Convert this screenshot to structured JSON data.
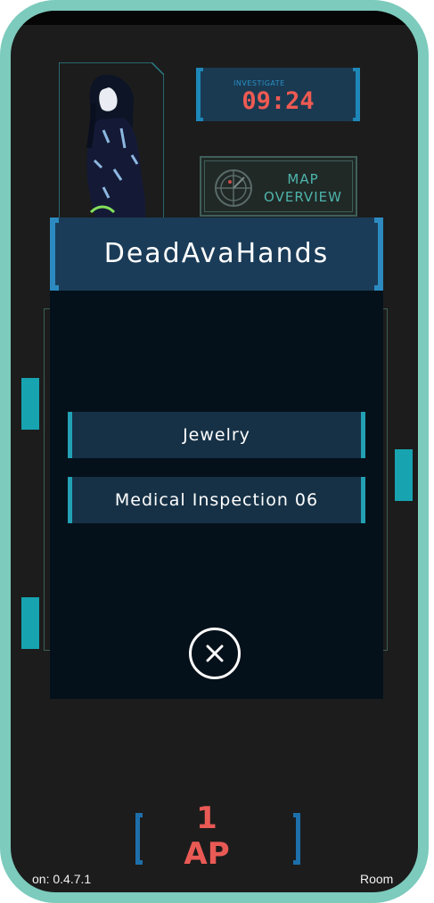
{
  "timer": {
    "label": "INVESTIGATE",
    "value": "09:24"
  },
  "map_button": {
    "line1": "MAP",
    "line2": "OVERVIEW"
  },
  "modal": {
    "title": "DeadAvaHands",
    "options": [
      "Jewelry",
      "Medical Inspection 06"
    ],
    "close_icon": "close-icon"
  },
  "action_points": {
    "value": "1",
    "unit": "AP"
  },
  "footer": {
    "version": "on: 0.4.7.1",
    "room": "Room"
  },
  "colors": {
    "accent": "#17a3b0",
    "timer": "#ef5a52",
    "panel": "#1a3c58",
    "border": "#7ccbbd"
  }
}
